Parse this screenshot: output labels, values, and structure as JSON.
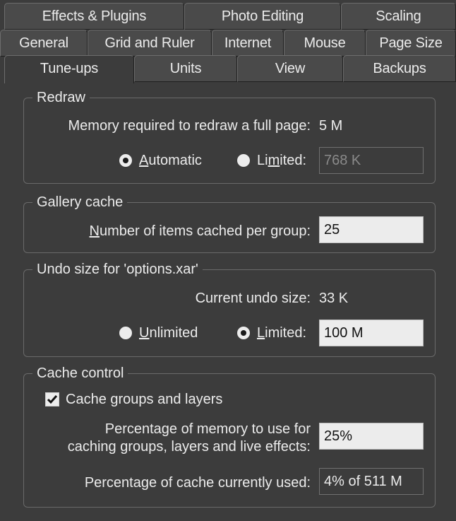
{
  "tabs": {
    "row1": [
      "Effects & Plugins",
      "Photo Editing",
      "Scaling"
    ],
    "row2": [
      "General",
      "Grid and Ruler",
      "Internet",
      "Mouse",
      "Page Size"
    ],
    "row3": [
      "Tune-ups",
      "Units",
      "View",
      "Backups"
    ],
    "active": "Tune-ups"
  },
  "redraw": {
    "legend": "Redraw",
    "memory_label": "Memory required to redraw a full page:",
    "memory_value": "5 M",
    "automatic_label": "Automatic",
    "limited_label": "Limited:",
    "limited_value": "768 K",
    "selected": "automatic"
  },
  "gallery_cache": {
    "legend": "Gallery cache",
    "items_label": "Number of items cached per group:",
    "items_value": "25"
  },
  "undo": {
    "legend": "Undo size for 'options.xar'",
    "current_label": "Current undo size:",
    "current_value": "33 K",
    "unlimited_label": "Unlimited",
    "limited_label": "Limited:",
    "limited_value": "100 M",
    "selected": "limited"
  },
  "cache_control": {
    "legend": "Cache control",
    "checkbox_label": "Cache groups and layers",
    "checkbox_checked": true,
    "percent_label_line1": "Percentage of memory to use for",
    "percent_label_line2": "caching groups, layers and live effects:",
    "percent_value": "25%",
    "used_label": "Percentage of cache currently used:",
    "used_value": "4% of 511 M"
  }
}
